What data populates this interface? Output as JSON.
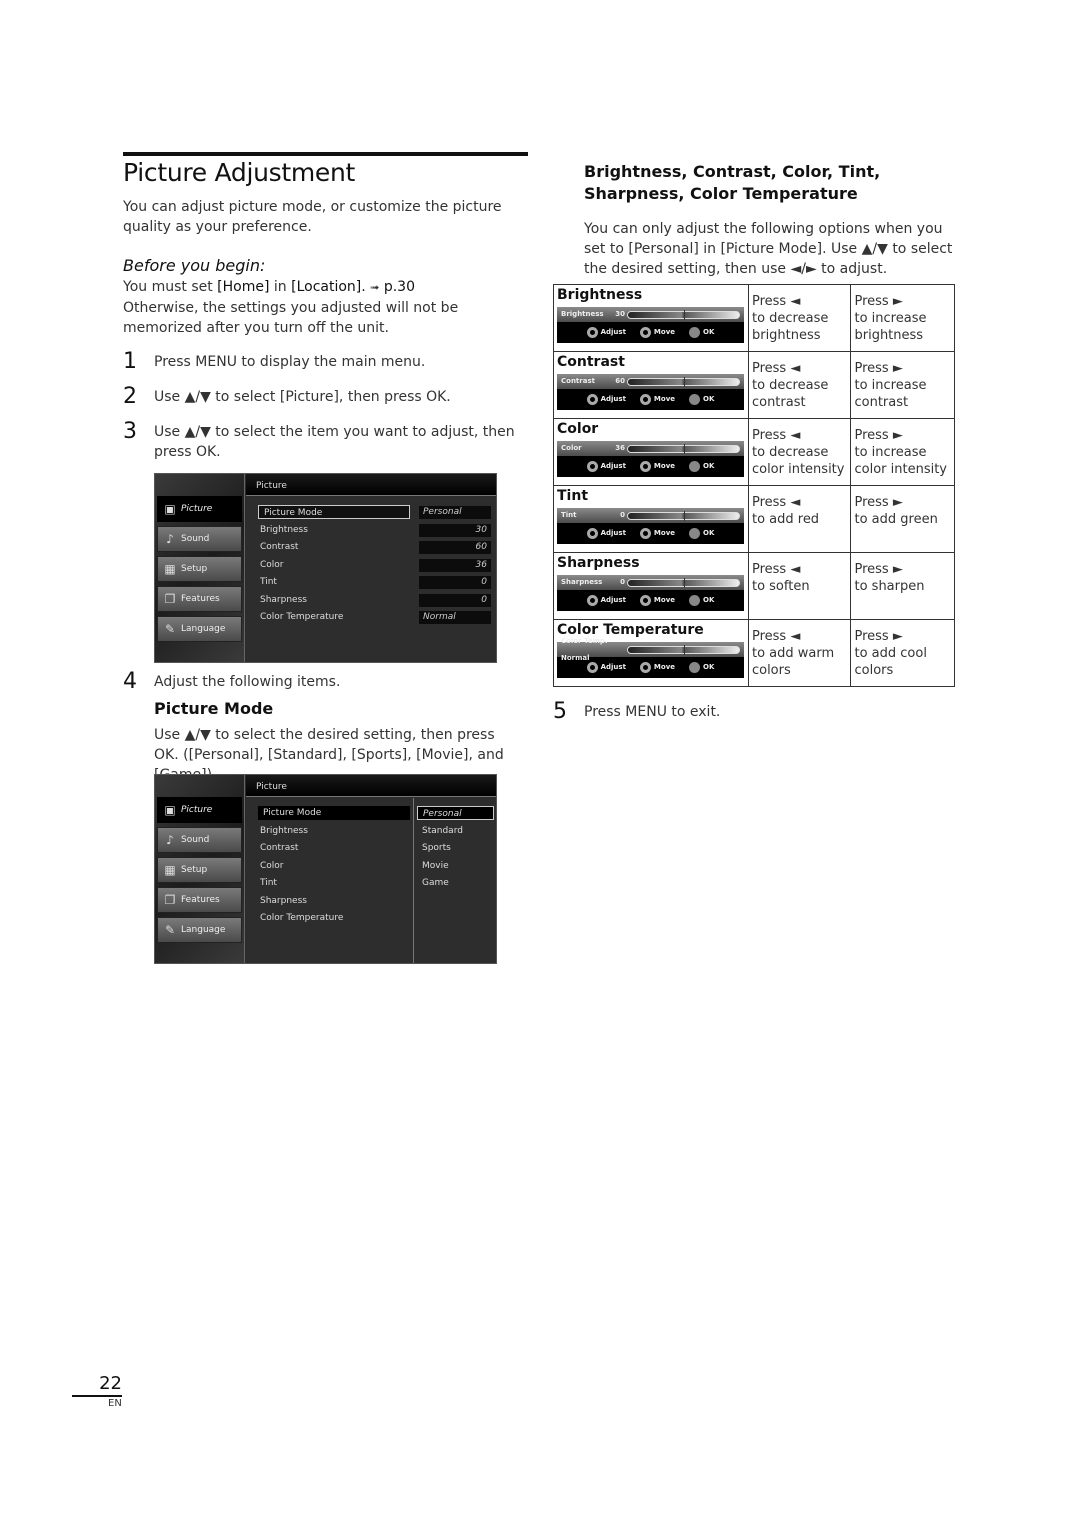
{
  "page": {
    "title": "Picture Adjustment",
    "intro": "You can adjust picture mode, or customize the picture quality as your preference.",
    "before_heading": "Before you begin:",
    "before_line1_pre": "You must set ",
    "before_home": "[Home]",
    "before_in": " in ",
    "before_location": "[Location].",
    "before_arrow": "➟",
    "before_ref": "p.30",
    "before_line2": "Otherwise, the settings you adjusted will not be memorized after you turn off the unit.",
    "steps": [
      {
        "num": "1",
        "text": "Press MENU to display the main menu."
      },
      {
        "num": "2",
        "text": "Use ▲/▼ to select [Picture], then press OK."
      },
      {
        "num": "3",
        "text": "Use ▲/▼ to select the item you want to adjust, then press OK."
      },
      {
        "num": "4",
        "text": "Adjust the following items."
      },
      {
        "num": "5",
        "text": "Press MENU to exit."
      }
    ],
    "picture_mode_heading": "Picture Mode",
    "picture_mode_text": "Use ▲/▼ to select the desired setting, then press OK. ([Personal], [Standard], [Sports], [Movie], and [Game])",
    "right_heading": "Brightness, Contrast, Color, Tint, Sharpness, Color Temperature",
    "right_text": "You can only adjust the following options when you set to [Personal] in [Picture Mode]. Use ▲/▼ to select the desired setting, then use ◄/► to adjust.",
    "page_number": "22",
    "lang": "EN"
  },
  "menu": {
    "header": "Picture",
    "sidebar": [
      {
        "label": "Picture",
        "icon": "picture-icon",
        "glyph": "▣"
      },
      {
        "label": "Sound",
        "icon": "music-note-icon",
        "glyph": "♪"
      },
      {
        "label": "Setup",
        "icon": "grid-icon",
        "glyph": "▦"
      },
      {
        "label": "Features",
        "icon": "pages-icon",
        "glyph": "❐"
      },
      {
        "label": "Language",
        "icon": "language-icon",
        "glyph": "✎"
      }
    ],
    "items": [
      {
        "label": "Picture Mode",
        "value": "Personal"
      },
      {
        "label": "Brightness",
        "value": "30"
      },
      {
        "label": "Contrast",
        "value": "60"
      },
      {
        "label": "Color",
        "value": "36"
      },
      {
        "label": "Tint",
        "value": "0"
      },
      {
        "label": "Sharpness",
        "value": "0"
      },
      {
        "label": "Color Temperature",
        "value": "Normal"
      }
    ],
    "mode_options": [
      "Personal",
      "Standard",
      "Sports",
      "Movie",
      "Game"
    ]
  },
  "table": {
    "osd_adjust": "Adjust",
    "osd_move": "Move",
    "osd_ok": "OK",
    "rows": [
      {
        "name": "Brightness",
        "osd_label": "Brightness",
        "osd_value": "30",
        "left": "Press ◄",
        "left_desc": "to decrease brightness",
        "right": "Press ►",
        "right_desc": "to increase brightness"
      },
      {
        "name": "Contrast",
        "osd_label": "Contrast",
        "osd_value": "60",
        "left": "Press ◄",
        "left_desc": "to decrease contrast",
        "right": "Press ►",
        "right_desc": "to increase contrast"
      },
      {
        "name": "Color",
        "osd_label": "Color",
        "osd_value": "36",
        "left": "Press ◄",
        "left_desc": "to decrease color intensity",
        "right": "Press ►",
        "right_desc": "to increase color intensity"
      },
      {
        "name": "Tint",
        "osd_label": "Tint",
        "osd_value": "0",
        "left": "Press ◄",
        "left_desc": "to add red",
        "right": "Press ►",
        "right_desc": "to add green"
      },
      {
        "name": "Sharpness",
        "osd_label": "Sharpness",
        "osd_value": "0",
        "left": "Press ◄",
        "left_desc": "to soften",
        "right": "Press ►",
        "right_desc": "to sharpen"
      },
      {
        "name": "Color Temperature",
        "osd_label": "Color Temp. Normal",
        "osd_value": "",
        "left": "Press ◄",
        "left_desc": "to add warm colors",
        "right": "Press ►",
        "right_desc": "to add cool colors"
      }
    ]
  }
}
